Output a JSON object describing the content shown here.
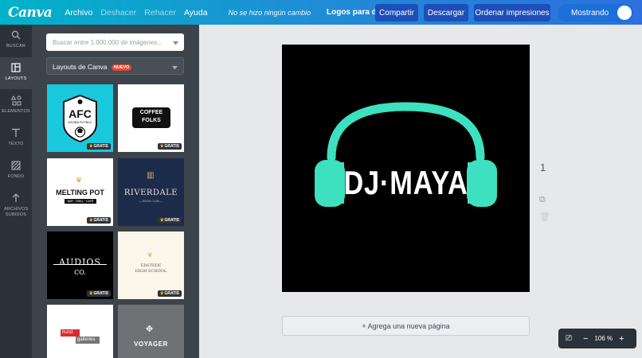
{
  "topbar": {
    "logo": "Canva",
    "menu": [
      "Archivo",
      "Deshacer",
      "Rehacer",
      "Ayuda"
    ],
    "status": "No se hizo ningún cambio",
    "doc_title": "Logos para dj",
    "share": "Compartir",
    "download": "Descargar",
    "order_prints": "Ordenar impresiones",
    "mode": "Mostrando"
  },
  "rail": {
    "items": [
      "BUSCAR",
      "LAYOUTS",
      "ELEMENTOS",
      "TEXTO",
      "FONDO",
      "ARCHIVOS SUBIDOS"
    ]
  },
  "panel": {
    "search_placeholder": "Buscar entre 1.000.000 de imágenes...",
    "layouts_label": "Layouts de Canva",
    "new_badge": "NUEVO",
    "free_badge": "GRATIS",
    "thumbs": {
      "afc": "AFC",
      "afc_sub": "ASOBA FUTBOL",
      "coffee1": "COFFEE",
      "coffee2": "FOLKS",
      "melting": "MELTING POT",
      "melting_sub": "BAR · GRILL · CAFÉ",
      "riverdale": "RIVERDALE",
      "riverdale_sub": "— BOOK CLUB —",
      "audios": "AUDIOS",
      "audios_co": "CO.",
      "edstede1": "EDSTEDE",
      "edstede2": "HIGH SCHOOL",
      "hurst": "hurst",
      "galleries": "galleries",
      "voyager": "VOYAGER"
    }
  },
  "canvas": {
    "logo_text": "DJ·MAYA",
    "page_number": "1",
    "add_page": "+ Agrega una nueva página",
    "zoom": "106 %",
    "colors": {
      "headphone": "#3de0bf",
      "background": "#000000"
    }
  }
}
